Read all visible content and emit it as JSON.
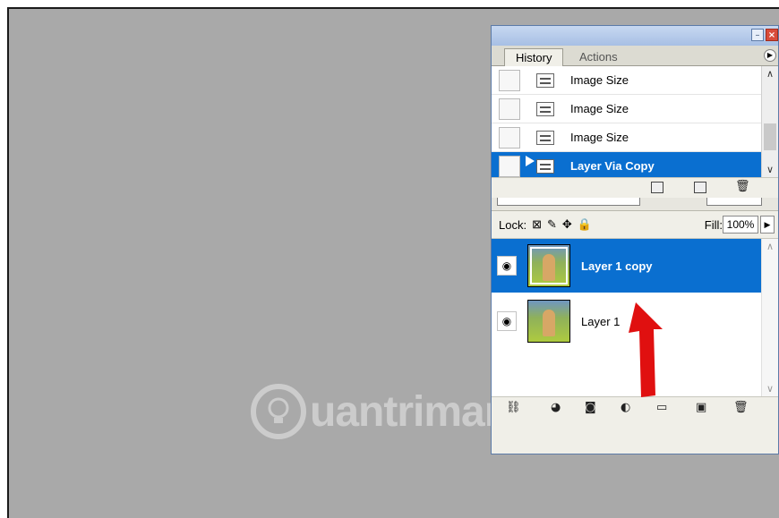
{
  "watermark": {
    "text": "uantrimang"
  },
  "history_panel": {
    "tabs": [
      {
        "label": "History",
        "active": true
      },
      {
        "label": "Actions",
        "active": false
      }
    ],
    "states": [
      {
        "label": "Image Size",
        "active": false
      },
      {
        "label": "Image Size",
        "active": false
      },
      {
        "label": "Image Size",
        "active": false
      },
      {
        "label": "Layer Via Copy",
        "active": true
      }
    ]
  },
  "layers_panel": {
    "lock_label": "Lock:",
    "fill_label": "Fill:",
    "fill_value": "100%",
    "layers": [
      {
        "name": "Layer 1 copy",
        "visible": true,
        "selected": true
      },
      {
        "name": "Layer 1",
        "visible": true,
        "selected": false
      }
    ]
  },
  "colors": {
    "canvas_gray": "#a9a9a9",
    "selection_blue": "#0a6fd0",
    "annotation_arrow": "#e01010"
  },
  "icons": {
    "history_footer": [
      "new-document-icon",
      "snapshot-camera-icon",
      "trash-icon"
    ],
    "layers_footer": [
      "link-icon",
      "layer-style-icon",
      "mask-icon",
      "adjustment-icon",
      "group-folder-icon",
      "new-layer-icon",
      "trash-icon"
    ]
  }
}
